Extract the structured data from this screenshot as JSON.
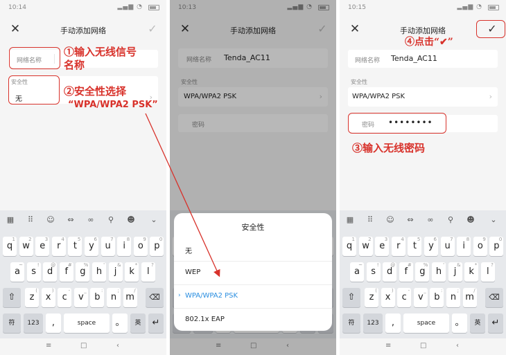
{
  "screens": [
    {
      "status_time": "10:14",
      "title": "手动添加网络",
      "network_label": "网络名称",
      "security_label": "安全性",
      "security_value": "无",
      "annotation1_line1": "①输入无线信号",
      "annotation1_line2": "名称",
      "annotation2_line1": "②安全性选择",
      "annotation2_line2": "“WPA/WPA2 PSK”"
    },
    {
      "status_time": "10:13",
      "title": "手动添加网络",
      "network_label": "网络名称",
      "network_value": "Tenda_AC11",
      "section_label": "安全性",
      "security_value": "WPA/WPA2 PSK",
      "password_label": "密码",
      "sheet_title": "安全性",
      "options": [
        "无",
        "WEP",
        "WPA/WPA2 PSK",
        "802.1x EAP"
      ],
      "selected_option": "WPA/WPA2 PSK"
    },
    {
      "status_time": "10:15",
      "title": "手动添加网络",
      "network_label": "网络名称",
      "network_value": "Tenda_AC11",
      "section_label": "安全性",
      "security_value": "WPA/WPA2 PSK",
      "password_label": "密码",
      "password_value": "••••••••",
      "annotation3": "③输入无线密码",
      "annotation4": "④点击“✔”"
    }
  ],
  "keyboard": {
    "row1": [
      "q",
      "w",
      "e",
      "r",
      "t",
      "y",
      "u",
      "i",
      "o",
      "p"
    ],
    "row1_sub": [
      "1",
      "2",
      "3",
      "4",
      "5",
      "6",
      "7",
      "8",
      "9",
      "0"
    ],
    "row2": [
      "a",
      "s",
      "d",
      "f",
      "g",
      "h",
      "j",
      "k",
      "l"
    ],
    "row2_sub": [
      "~",
      "!",
      "@",
      "#",
      "%",
      "'",
      "&",
      "*",
      "?"
    ],
    "row3": [
      "z",
      "x",
      "c",
      "v",
      "b",
      "n",
      "m"
    ],
    "row3_sub": [
      "(",
      ")",
      "-",
      "_",
      ":",
      ";",
      "/"
    ],
    "sym_key": "符",
    "num_key": "123",
    "comma_key": ",",
    "space_key": "space",
    "period_key": "。",
    "lang_key": "英"
  },
  "colors": {
    "annotation": "#d8322b",
    "selected": "#2a8ee0"
  },
  "icons": {
    "close": "close-icon",
    "confirm": "check-icon",
    "dropdown": "chevron-right-icon"
  }
}
